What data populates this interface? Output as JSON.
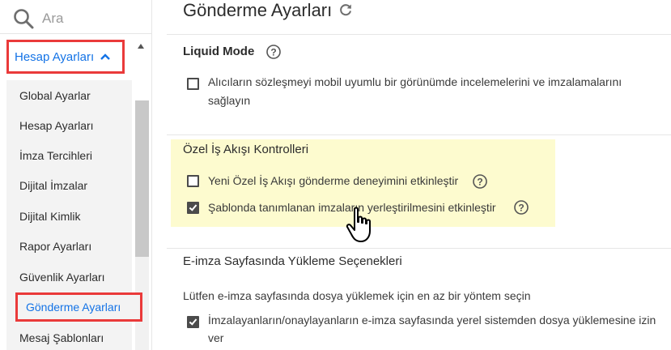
{
  "sidebar": {
    "search_placeholder": "Ara",
    "section_title": "Hesap Ayarları",
    "items": [
      {
        "label": "Global Ayarlar"
      },
      {
        "label": "Hesap Ayarları"
      },
      {
        "label": "İmza Tercihleri"
      },
      {
        "label": "Dijital İmzalar"
      },
      {
        "label": "Dijital Kimlik"
      },
      {
        "label": "Rapor Ayarları"
      },
      {
        "label": "Güvenlik Ayarları"
      },
      {
        "label": "Gönderme Ayarları",
        "active": true
      },
      {
        "label": "Mesaj Şablonları"
      }
    ]
  },
  "main": {
    "title": "Gönderme Ayarları",
    "liquid": {
      "title": "Liquid Mode",
      "option_line1": "Alıcıların sözleşmeyi mobil uyumlu bir görünümde incelemelerini ve imzalamalarını",
      "option_line2": "sağlayın",
      "checked": false
    },
    "workflow": {
      "title": "Özel İş Akışı Kontrolleri",
      "options": [
        {
          "label": "Yeni Özel İş Akışı gönderme deneyimini etkinleştir",
          "checked": false
        },
        {
          "label": "Şablonda tanımlanan imzaların yerleştirilmesini etkinleştir",
          "checked": true
        }
      ]
    },
    "upload": {
      "title": "E-imza Sayfasında Yükleme Seçenekleri",
      "instruction": "Lütfen e-imza sayfasında dosya yüklemek için en az bir yöntem seçin",
      "option_line1": "İmzalayanların/onaylayanların e-imza sayfasında yerel sistemden dosya yüklemesine izin",
      "option_line2": "ver",
      "checked": true
    }
  },
  "colors": {
    "accent": "#1473e6",
    "annotation_red": "#ea3a3a",
    "highlight": "#fdfbcf"
  }
}
